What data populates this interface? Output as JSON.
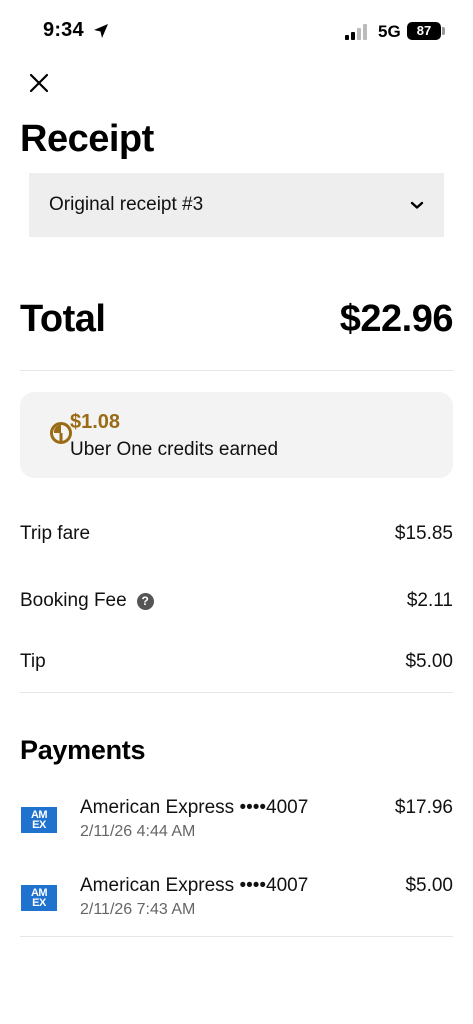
{
  "status_bar": {
    "time": "9:34",
    "network": "5G",
    "battery": "87"
  },
  "header": {
    "title": "Receipt"
  },
  "receipt_selector": {
    "selected": "Original receipt #3"
  },
  "total": {
    "label": "Total",
    "value": "$22.96"
  },
  "credits": {
    "amount": "$1.08",
    "text": "Uber One credits earned",
    "accent_color": "#9a6b14"
  },
  "fare_items": [
    {
      "label": "Trip fare",
      "value": "$15.85"
    },
    {
      "label": "Booking Fee",
      "value": "$2.11",
      "help_icon": "?"
    },
    {
      "label": "Tip",
      "value": "$5.00"
    }
  ],
  "payments": {
    "heading": "Payments",
    "items": [
      {
        "card_logo": "AMEX",
        "card_logo_line1": "AM",
        "card_logo_line2": "EX",
        "name": "American Express ••••4007",
        "date": "2/11/26 4:44 AM",
        "amount": "$17.96"
      },
      {
        "card_logo": "AMEX",
        "card_logo_line1": "AM",
        "card_logo_line2": "EX",
        "name": "American Express ••••4007",
        "date": "2/11/26 7:43 AM",
        "amount": "$5.00"
      }
    ]
  }
}
